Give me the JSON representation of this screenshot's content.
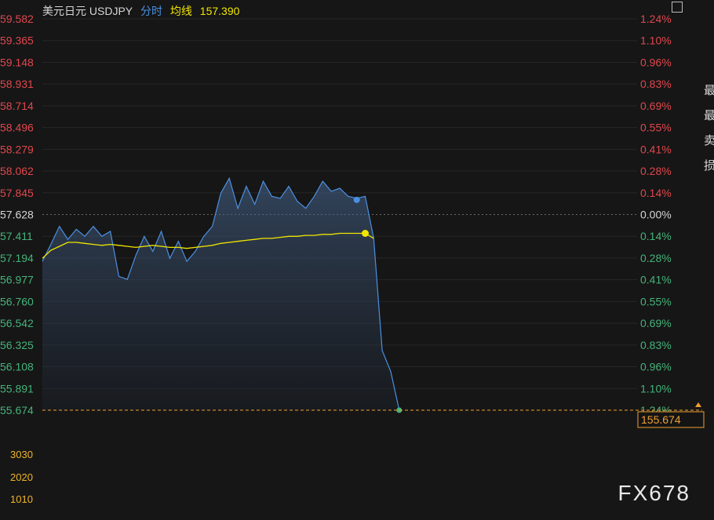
{
  "header": {
    "title": "美元日元 USDJPY",
    "mode": "分时",
    "avg_label": "均线",
    "avg_value": "157.390"
  },
  "watermark": "FX678",
  "current_price_label": "155.674",
  "volume_labels": [
    "3030",
    "2020",
    "1010"
  ],
  "side_panel": [
    "最",
    "最",
    "卖",
    "损"
  ],
  "colors": {
    "background": "#161616",
    "up": "#e0474d",
    "down": "#45b37a",
    "neutral": "#d6d6d6",
    "price_line": "#4a90e2",
    "avg_line": "#f2e600",
    "volume_label": "#f0b429",
    "mode_text": "#4a90e2",
    "grid": "#262626"
  },
  "chart_data": {
    "type": "line",
    "title": "美元日元 USDJPY",
    "xlabel": "",
    "ylabel": "",
    "ylim": [
      155.674,
      159.582
    ],
    "reference_price": 157.628,
    "y_ticks": [
      "59.582",
      "59.365",
      "59.148",
      "58.931",
      "58.714",
      "58.496",
      "58.279",
      "58.062",
      "57.845",
      "57.628",
      "57.411",
      "57.194",
      "56.977",
      "56.760",
      "56.542",
      "56.325",
      "56.108",
      "55.891",
      "55.674"
    ],
    "pct_ticks": [
      "1.24%",
      "1.10%",
      "0.96%",
      "0.83%",
      "0.69%",
      "0.55%",
      "0.41%",
      "0.28%",
      "0.14%",
      "0.00%",
      "0.14%",
      "0.28%",
      "0.41%",
      "0.55%",
      "0.69%",
      "0.83%",
      "0.96%",
      "1.10%",
      "1.24%"
    ],
    "x": [
      0,
      1,
      2,
      3,
      4,
      5,
      6,
      7,
      8,
      9,
      10,
      11,
      12,
      13,
      14,
      15,
      16,
      17,
      18,
      19,
      20,
      21,
      22,
      23,
      24,
      25,
      26,
      27,
      28,
      29,
      30,
      31,
      32,
      33,
      34,
      35,
      36,
      37,
      38,
      39,
      40,
      41,
      42
    ],
    "series": [
      {
        "values": [
          157.16,
          157.33,
          157.51,
          157.38,
          157.48,
          157.41,
          157.51,
          157.41,
          157.46,
          157.01,
          156.98,
          157.22,
          157.41,
          157.26,
          157.46,
          157.19,
          157.36,
          157.16,
          157.26,
          157.41,
          157.51,
          157.84,
          157.99,
          157.69,
          157.91,
          157.73,
          157.96,
          157.81,
          157.79,
          157.91,
          157.76,
          157.69,
          157.81,
          157.96,
          157.86,
          157.89,
          157.81,
          157.79,
          157.81,
          157.39,
          156.27,
          156.06,
          155.674
        ]
      },
      {
        "values": [
          157.19,
          157.27,
          157.31,
          157.35,
          157.35,
          157.34,
          157.33,
          157.32,
          157.33,
          157.32,
          157.31,
          157.3,
          157.31,
          157.32,
          157.31,
          157.3,
          157.3,
          157.29,
          157.3,
          157.31,
          157.32,
          157.34,
          157.35,
          157.36,
          157.37,
          157.38,
          157.39,
          157.39,
          157.4,
          157.41,
          157.41,
          157.42,
          157.42,
          157.43,
          157.43,
          157.44,
          157.44,
          157.44,
          157.44,
          157.39
        ]
      }
    ]
  }
}
